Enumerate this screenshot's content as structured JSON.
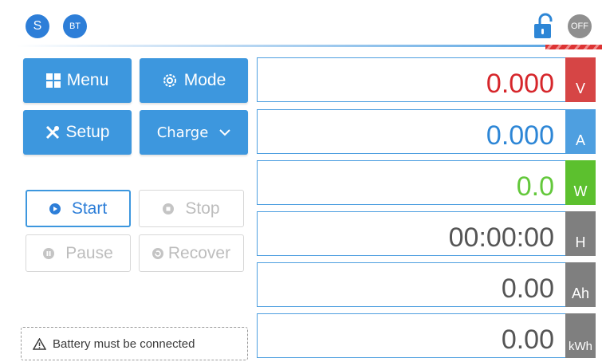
{
  "header": {
    "badge_s": "S",
    "badge_bt": "BT",
    "power_state": "OFF",
    "lock_icon": "unlocked-padlock-icon"
  },
  "buttons": {
    "menu": "Menu",
    "mode": "Mode",
    "setup": "Setup",
    "charge_mode": "Charge",
    "start": "Start",
    "stop": "Stop",
    "pause": "Pause",
    "recover": "Recover"
  },
  "warning": "Battery must be connected",
  "readouts": [
    {
      "value": "0.000",
      "unit": "V",
      "value_color": "#d6262b",
      "unit_color": "#d64545"
    },
    {
      "value": "0.000",
      "unit": "A",
      "value_color": "#2d86d6",
      "unit_color": "#4e9fe0"
    },
    {
      "value": "0.0",
      "unit": "W",
      "value_color": "#63c83b",
      "unit_color": "#5cc02e"
    },
    {
      "value": "00:00:00",
      "unit": "H",
      "value_color": "#555555",
      "unit_color": "#7f7f7f"
    },
    {
      "value": "0.00",
      "unit": "Ah",
      "value_color": "#555555",
      "unit_color": "#7f7f7f"
    },
    {
      "value": "0.00",
      "unit": "kWh",
      "value_color": "#555555",
      "unit_color": "#7f7f7f"
    }
  ]
}
